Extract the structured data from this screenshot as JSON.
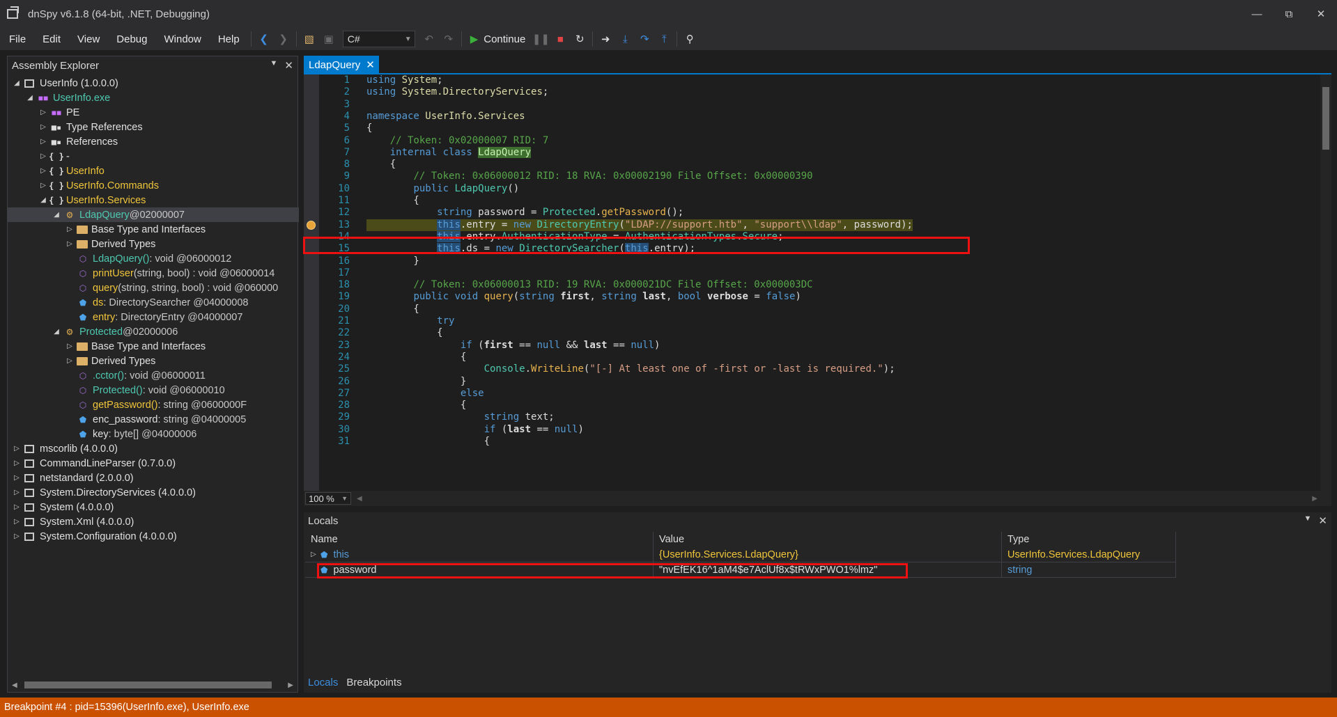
{
  "window": {
    "title": "dnSpy v6.1.8 (64-bit, .NET, Debugging)"
  },
  "menu": [
    "File",
    "Edit",
    "View",
    "Debug",
    "Window",
    "Help"
  ],
  "toolbar": {
    "language": "C#",
    "continue_label": "Continue"
  },
  "assembly_explorer": {
    "title": "Assembly Explorer",
    "rows": [
      {
        "arrow": "◢",
        "icon": "asm",
        "text": "UserInfo (1.0.0.0)",
        "cls": "t-white",
        "indent": 0
      },
      {
        "arrow": "◢",
        "icon": "exe",
        "text": "UserInfo.exe",
        "cls": "t-teal",
        "indent": 1
      },
      {
        "arrow": "▷",
        "icon": "pe",
        "text": "PE",
        "cls": "t-white",
        "indent": 2
      },
      {
        "arrow": "▷",
        "icon": "ref",
        "text": "Type References",
        "cls": "t-white",
        "indent": 2
      },
      {
        "arrow": "▷",
        "icon": "ref",
        "text": "References",
        "cls": "t-white",
        "indent": 2
      },
      {
        "arrow": "▷",
        "icon": "ns",
        "text": "-",
        "cls": "t-white",
        "indent": 2
      },
      {
        "arrow": "▷",
        "icon": "ns",
        "text": "UserInfo",
        "cls": "t-yellow",
        "indent": 2
      },
      {
        "arrow": "▷",
        "icon": "ns",
        "text": "UserInfo.Commands",
        "cls": "t-yellow",
        "indent": 2
      },
      {
        "arrow": "◢",
        "icon": "ns",
        "text": "UserInfo.Services",
        "cls": "t-yellow",
        "indent": 2
      },
      {
        "arrow": "◢",
        "icon": "class",
        "text": "LdapQuery",
        "suffix": " @02000007",
        "cls": "t-teal",
        "indent": 3,
        "selected": true
      },
      {
        "arrow": "▷",
        "icon": "folder",
        "text": "Base Type and Interfaces",
        "cls": "t-white",
        "indent": 4
      },
      {
        "arrow": "▷",
        "icon": "folder",
        "text": "Derived Types",
        "cls": "t-white",
        "indent": 4
      },
      {
        "arrow": "",
        "icon": "method",
        "text": "LdapQuery()",
        "suffix": " : void @06000012",
        "cls": "t-teal",
        "indent": 4
      },
      {
        "arrow": "",
        "icon": "method",
        "text": "printUser",
        "suffix": "(string, bool) : void @06000014",
        "cls": "t-yellow",
        "indent": 4
      },
      {
        "arrow": "",
        "icon": "method",
        "text": "query",
        "suffix": "(string, string, bool) : void @060000",
        "cls": "t-yellow",
        "indent": 4
      },
      {
        "arrow": "",
        "icon": "field",
        "text": "ds",
        "suffix": " : DirectorySearcher @04000008",
        "cls": "t-yellow",
        "indent": 4
      },
      {
        "arrow": "",
        "icon": "field",
        "text": "entry",
        "suffix": " : DirectoryEntry @04000007",
        "cls": "t-yellow",
        "indent": 4
      },
      {
        "arrow": "◢",
        "icon": "class",
        "text": "Protected",
        "suffix": " @02000006",
        "cls": "t-teal",
        "indent": 3
      },
      {
        "arrow": "▷",
        "icon": "folder",
        "text": "Base Type and Interfaces",
        "cls": "t-white",
        "indent": 4
      },
      {
        "arrow": "▷",
        "icon": "folder",
        "text": "Derived Types",
        "cls": "t-white",
        "indent": 4
      },
      {
        "arrow": "",
        "icon": "method",
        "text": ".cctor()",
        "suffix": " : void @06000011",
        "cls": "t-teal",
        "indent": 4
      },
      {
        "arrow": "",
        "icon": "method",
        "text": "Protected()",
        "suffix": " : void @06000010",
        "cls": "t-teal",
        "indent": 4
      },
      {
        "arrow": "",
        "icon": "method",
        "text": "getPassword()",
        "suffix": " : string @0600000F",
        "cls": "t-yellow",
        "indent": 4
      },
      {
        "arrow": "",
        "icon": "field",
        "text": "enc_password",
        "suffix": " : string @04000005",
        "cls": "t-white",
        "indent": 4
      },
      {
        "arrow": "",
        "icon": "field",
        "text": "key",
        "suffix": " : byte[] @04000006",
        "cls": "t-white",
        "indent": 4
      },
      {
        "arrow": "▷",
        "icon": "asm",
        "text": "mscorlib (4.0.0.0)",
        "cls": "t-white",
        "indent": 0
      },
      {
        "arrow": "▷",
        "icon": "asm",
        "text": "CommandLineParser (0.7.0.0)",
        "cls": "t-white",
        "indent": 0
      },
      {
        "arrow": "▷",
        "icon": "asm",
        "text": "netstandard (2.0.0.0)",
        "cls": "t-white",
        "indent": 0
      },
      {
        "arrow": "▷",
        "icon": "asm",
        "text": "System.DirectoryServices (4.0.0.0)",
        "cls": "t-white",
        "indent": 0
      },
      {
        "arrow": "▷",
        "icon": "asm",
        "text": "System (4.0.0.0)",
        "cls": "t-white",
        "indent": 0
      },
      {
        "arrow": "▷",
        "icon": "asm",
        "text": "System.Xml (4.0.0.0)",
        "cls": "t-white",
        "indent": 0
      },
      {
        "arrow": "▷",
        "icon": "asm",
        "text": "System.Configuration (4.0.0.0)",
        "cls": "t-white",
        "indent": 0
      }
    ]
  },
  "editor": {
    "tab_label": "LdapQuery",
    "zoom": "100 %",
    "current_line": 13,
    "lines": [
      "<span class=\"k\">using</span> <span class=\"mt\">System</span>;",
      "<span class=\"k\">using</span> <span class=\"mt\">System.DirectoryServices</span>;",
      "",
      "<span class=\"k\">namespace</span> <span class=\"mt\">UserInfo.Services</span>",
      "{",
      "    <span class=\"cm\">// Token: 0x02000007 RID: 7</span>",
      "    <span class=\"k\">internal class</span> <span class=\"cls-hl\">LdapQuery</span>",
      "    {",
      "        <span class=\"cm\">// Token: 0x06000012 RID: 18 RVA: 0x00002190 File Offset: 0x00000390</span>",
      "        <span class=\"k\">public</span> <span class=\"ty\">LdapQuery</span>()",
      "        {",
      "            <span class=\"k\">string</span> password = <span class=\"ty\">Protected</span>.<span class=\"me\">getPassword</span>();",
      "            <span class=\"k hl\">this</span>.entry = <span class=\"k\">new</span> <span class=\"ty\">DirectoryEntry</span>(<span class=\"st\">\"LDAP://support.htb\"</span>, <span class=\"st\">\"support\\\\ldap\"</span>, password);",
      "            <span class=\"k hl\">this</span>.entry.<span class=\"ty\">AuthenticationType</span> = <span class=\"ty\">AuthenticationTypes</span>.<span class=\"ty\">Secure</span>;",
      "            <span class=\"k hl\">this</span>.ds = <span class=\"k\">new</span> <span class=\"ty\">DirectorySearcher</span>(<span class=\"k hl\">this</span>.entry);",
      "        }",
      "",
      "        <span class=\"cm\">// Token: 0x06000013 RID: 19 RVA: 0x000021DC File Offset: 0x000003DC</span>",
      "        <span class=\"k\">public void</span> <span class=\"me\">query</span>(<span class=\"k\">string</span> <b>first</b>, <span class=\"k\">string</span> <b>last</b>, <span class=\"k\">bool</span> <b>verbose</b> = <span class=\"k\">false</span>)",
      "        {",
      "            <span class=\"k\">try</span>",
      "            {",
      "                <span class=\"k\">if</span> (<b>first</b> == <span class=\"k\">null</span> &amp;&amp; <b>last</b> == <span class=\"k\">null</span>)",
      "                {",
      "                    <span class=\"ty\">Console</span>.<span class=\"me\">WriteLine</span>(<span class=\"st\">\"[-] At least one of -first or -last is required.\"</span>);",
      "                }",
      "                <span class=\"k\">else</span>",
      "                {",
      "                    <span class=\"k\">string</span> text;",
      "                    <span class=\"k\">if</span> (<b>last</b> == <span class=\"k\">null</span>)",
      "                    {"
    ]
  },
  "locals": {
    "title": "Locals",
    "headers": {
      "name": "Name",
      "value": "Value",
      "type": "Type"
    },
    "rows": [
      {
        "name": "this",
        "value": "{UserInfo.Services.LdapQuery}",
        "type": "UserInfo.Services.LdapQuery"
      },
      {
        "name": "password",
        "value": "\"nvEfEK16^1aM4$e7AclUf8x$tRWxPWO1%lmz\"",
        "type": "string"
      }
    ],
    "tabs": [
      "Locals",
      "Breakpoints"
    ]
  },
  "status": {
    "text": "Breakpoint #4 : pid=15396(UserInfo.exe), UserInfo.exe"
  }
}
